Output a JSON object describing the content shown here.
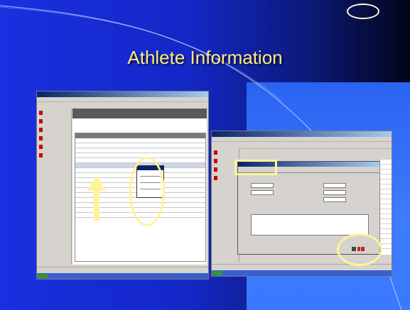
{
  "slide": {
    "title": "Athlete Information"
  },
  "colors": {
    "title_text": "#ffeb7a",
    "highlight": "#fff39a",
    "background_left": "#1a2fe0",
    "background_right": "#020418"
  },
  "shots": {
    "first": {
      "icon": "app-window-screenshot"
    },
    "second": {
      "icon": "app-dialog-screenshot"
    }
  },
  "annotations": {
    "arrow": "up-arrow-icon",
    "oval": "highlight-oval",
    "rect": "highlight-rectangle"
  }
}
